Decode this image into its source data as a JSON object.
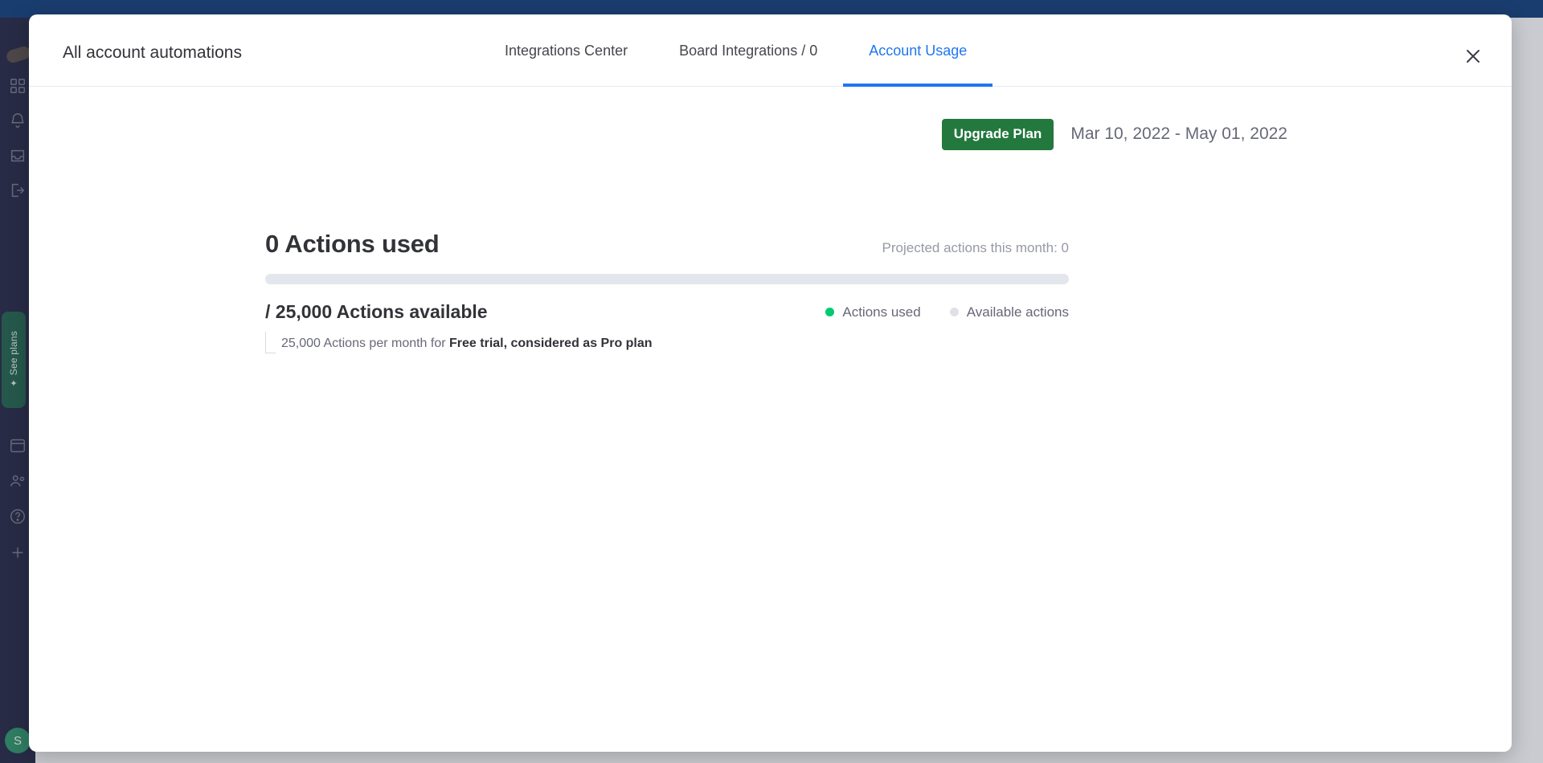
{
  "app": {
    "sidebar": {
      "logo_icon": "monday-logo-icon",
      "nav_icons": [
        {
          "name": "home-icon"
        },
        {
          "name": "notifications-bell-icon"
        },
        {
          "name": "inbox-icon"
        },
        {
          "name": "invite-icon"
        }
      ],
      "lower_icons": [
        {
          "name": "templates-icon"
        },
        {
          "name": "apps-icon"
        },
        {
          "name": "help-icon"
        },
        {
          "name": "add-icon"
        }
      ],
      "see_plans_label": "See plans",
      "sparkle_icon": "✦",
      "avatar_initial": "S"
    }
  },
  "modal": {
    "title": "All account automations",
    "close_icon": "close-icon",
    "tabs": [
      {
        "id": "integrations-center",
        "label": "Integrations Center",
        "active": false
      },
      {
        "id": "board-integrations",
        "label": "Board Integrations / 0",
        "active": false
      },
      {
        "id": "account-usage",
        "label": "Account Usage",
        "active": true
      }
    ]
  },
  "usage": {
    "upgrade_button_label": "Upgrade Plan",
    "date_range": "Mar 10, 2022 - May 01, 2022",
    "actions_used_heading": "0 Actions used",
    "projected_actions": "Projected actions this month: 0",
    "actions_available_heading": "/ 25,000 Actions available",
    "legend": [
      {
        "id": "actions-used",
        "label": "Actions used",
        "color": "#00ca72"
      },
      {
        "id": "available-actions",
        "label": "Available actions",
        "color": "#e0e1e6"
      }
    ],
    "plan_note_prefix": "25,000 Actions per month for ",
    "plan_note_strong": "Free trial, considered as Pro plan",
    "progress_percent": 0
  },
  "colors": {
    "accent_blue": "#1f76f0",
    "brand_green": "#00ca72",
    "upgrade_green": "#23783e",
    "top_bar_navy": "#1f4a83",
    "sidebar_navy": "#30324e"
  }
}
